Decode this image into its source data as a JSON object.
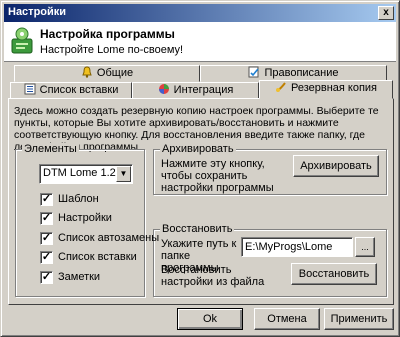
{
  "window": {
    "title": "Настройки",
    "close_label": "x"
  },
  "header": {
    "title": "Настройка программы",
    "subtitle": "Настройте Lome по-своему!"
  },
  "tabs": {
    "row1": [
      {
        "label": "Общие",
        "icon": "bell-icon"
      },
      {
        "label": "Правописание",
        "icon": "spellcheck-icon"
      }
    ],
    "row2": [
      {
        "label": "Список вставки",
        "icon": "list-icon"
      },
      {
        "label": "Интеграция",
        "icon": "integration-icon"
      },
      {
        "label": "Резервная копия",
        "icon": "backup-icon",
        "active": true
      }
    ]
  },
  "description": "Здесь можно создать резервную копию настроек программы. Выберите те пункты, которые Вы хотите архивировать/восстановить и нажмите соответствующую кнопку. Для восстановления введите также папку, где лежат файлы программы",
  "elements": {
    "title": "Элементы",
    "version_select": "DTM Lome 1.2",
    "items": [
      {
        "label": "Шаблон",
        "checked": true
      },
      {
        "label": "Настройки",
        "checked": true
      },
      {
        "label": "Список автозамены",
        "checked": true
      },
      {
        "label": "Список вставки",
        "checked": true
      },
      {
        "label": "Заметки",
        "checked": true
      }
    ]
  },
  "archive": {
    "title": "Архивировать",
    "text": "Нажмите эту кнопку, чтобы сохранить настройки программы",
    "button": "Архивировать"
  },
  "restore": {
    "title": "Восстановить",
    "path_label": "Укажите путь к папке программы",
    "path_value": "E:\\MyProgs\\Lome",
    "browse_label": "...",
    "restore_text": "Восстановить настройки из файла",
    "button": "Восстановить"
  },
  "footer": {
    "ok": "Ok",
    "cancel": "Отмена",
    "apply": "Применить"
  },
  "colors": {
    "titlebar_start": "#0a246a",
    "titlebar_end": "#a6caf0",
    "face": "#d4d0c8"
  }
}
